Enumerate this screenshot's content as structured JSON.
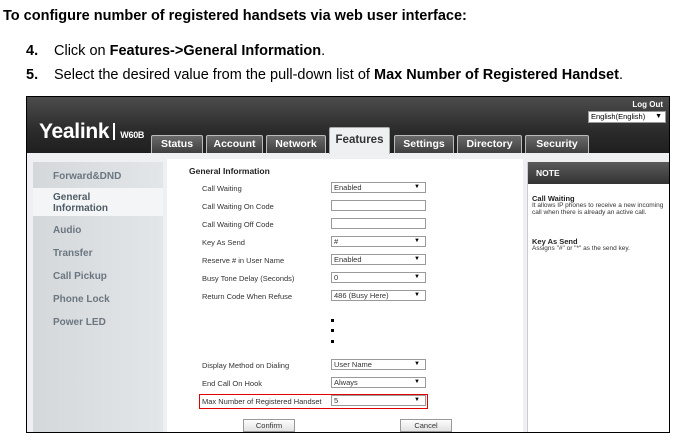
{
  "doc": {
    "heading": "To configure number of registered handsets via web user interface:",
    "step4": {
      "num": "4.",
      "pre": "Click on ",
      "bold": "Features->General Information",
      "post": "."
    },
    "step5": {
      "num": "5.",
      "pre": "Select the desired value from the pull-down list of ",
      "bold": "Max Number of Registered Handset",
      "post": "."
    }
  },
  "header": {
    "logo": "Yealink",
    "model": "W60B",
    "logout": "Log Out",
    "language": "English(English)"
  },
  "tabs": [
    "Status",
    "Account",
    "Network",
    "Features",
    "Settings",
    "Directory",
    "Security"
  ],
  "active_tab": "Features",
  "sidebar": {
    "items": [
      "Forward&DND",
      "General Information",
      "Audio",
      "Transfer",
      "Call Pickup",
      "Phone Lock",
      "Power LED"
    ],
    "active": "General Information"
  },
  "content": {
    "section_title": "General Information",
    "rows": [
      {
        "label": "Call Waiting",
        "value": "Enabled",
        "type": "select"
      },
      {
        "label": "Call Waiting On Code",
        "value": "",
        "type": "input"
      },
      {
        "label": "Call Waiting Off Code",
        "value": "",
        "type": "input"
      },
      {
        "label": "Key As Send",
        "value": "#",
        "type": "select"
      },
      {
        "label": "Reserve # in User Name",
        "value": "Enabled",
        "type": "select"
      },
      {
        "label": "Busy Tone Delay (Seconds)",
        "value": "0",
        "type": "select"
      },
      {
        "label": "Return Code When Refuse",
        "value": "486 (Busy Here)",
        "type": "select"
      },
      {
        "label": "Display Method on Dialing",
        "value": "User Name",
        "type": "select"
      },
      {
        "label": "End Call On Hook",
        "value": "Always",
        "type": "select"
      },
      {
        "label": "Max Number of Registered Handset",
        "value": "5",
        "type": "select"
      }
    ],
    "confirm": "Confirm",
    "cancel": "Cancel",
    "highlight_color": "#e00000"
  },
  "note": {
    "title": "NOTE",
    "entries": [
      {
        "title": "Call Waiting",
        "text": "It allows IP phones to receive a new incoming call when there is already an active call."
      },
      {
        "title": "Key As Send",
        "text": "Assigns \"#\" or \"*\" as the send key."
      }
    ]
  }
}
